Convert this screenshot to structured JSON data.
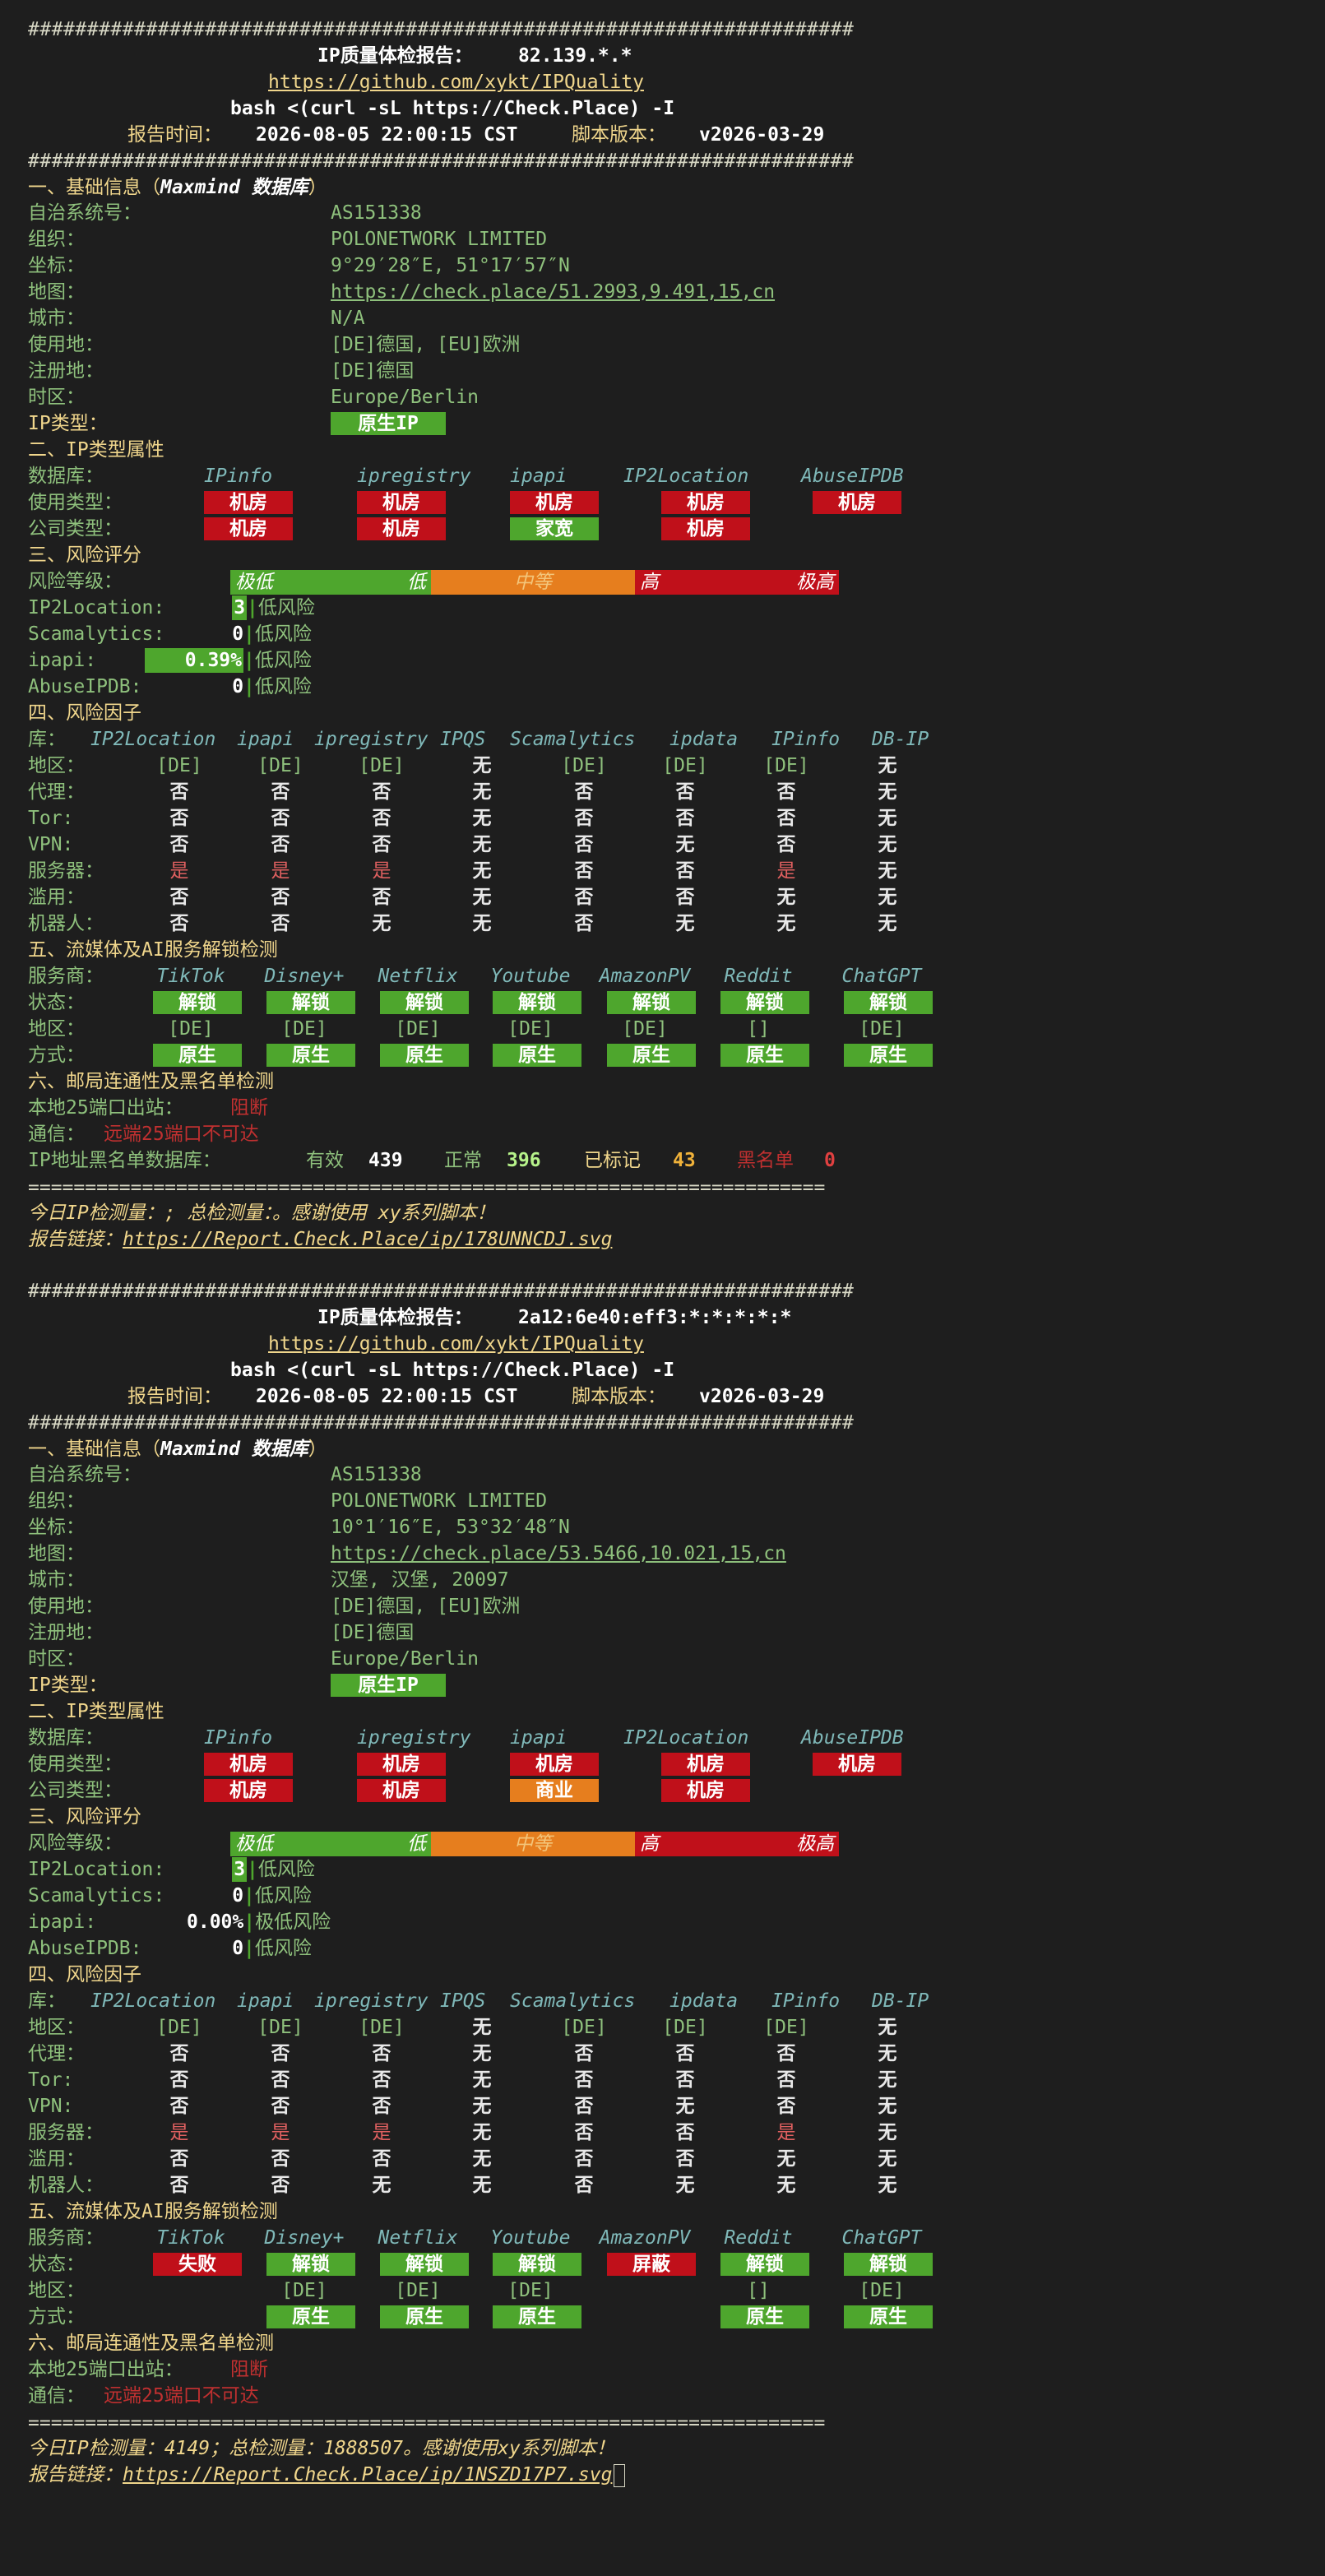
{
  "divider_hash": "######################################################################",
  "divider_eq": "======================================================================",
  "reports": [
    {
      "header": {
        "title_prefix": "IP质量体检报告：",
        "ip": "82.139.*.*",
        "repo": "https://github.com/xykt/IPQuality",
        "command": "bash <(curl -sL https://Check.Place) -I",
        "time_label": "报告时间：",
        "time_value": "2026-08-05 22:00:15 CST",
        "version_label": "脚本版本：",
        "version_value": "v2026-03-29"
      },
      "basic": {
        "title": "一、基础信息（",
        "db": "Maxmind 数据库",
        "title_end": "）",
        "rows": [
          {
            "label": "自治系统号：",
            "value": "AS151338"
          },
          {
            "label": "组织：",
            "value": "POLONETWORK LIMITED"
          },
          {
            "label": "坐标：",
            "value": "9°29′28″E, 51°17′57″N"
          },
          {
            "label": "地图：",
            "value": "https://check.place/51.2993,9.491,15,cn"
          },
          {
            "label": "城市：",
            "value": "N/A"
          },
          {
            "label": "使用地：",
            "value": "[DE]德国, [EU]欧洲"
          },
          {
            "label": "注册地：",
            "value": "[DE]德国"
          },
          {
            "label": "时区：",
            "value": "Europe/Berlin"
          }
        ],
        "ip_type_label": "IP类型：",
        "ip_type_value": "原生IP"
      },
      "iptype": {
        "title": "二、IP类型属性",
        "db_label": "数据库：",
        "dbs": [
          "IPinfo",
          "ipregistry",
          "ipapi",
          "IP2Location",
          "AbuseIPDB"
        ],
        "usage_label": "使用类型：",
        "usage": [
          {
            "t": "机房",
            "c": "r"
          },
          {
            "t": "机房",
            "c": "r"
          },
          {
            "t": "机房",
            "c": "r"
          },
          {
            "t": "机房",
            "c": "r"
          },
          {
            "t": "机房",
            "c": "r"
          }
        ],
        "company_label": "公司类型：",
        "company": [
          {
            "t": "机房",
            "c": "r"
          },
          {
            "t": "机房",
            "c": "r"
          },
          {
            "t": "家宽",
            "c": "g"
          },
          {
            "t": "机房",
            "c": "r"
          }
        ]
      },
      "risk": {
        "title": "三、风险评分",
        "level_label": "风险等级：",
        "levels": [
          "极低",
          "低",
          "中等",
          "高",
          "极高"
        ],
        "rows": [
          {
            "label": "IP2Location:",
            "score": "3",
            "text": "低风险",
            "fill": 0.03
          },
          {
            "label": "Scamalytics:",
            "score": "0",
            "text": "低风险",
            "fill": 0.0
          },
          {
            "label": "ipapi:",
            "score": "0.39%",
            "text": "低风险",
            "fill": 0.39
          },
          {
            "label": "AbuseIPDB:",
            "score": "0",
            "text": "低风险",
            "fill": 0.0
          }
        ]
      },
      "factors": {
        "title": "四、风险因子",
        "lib_label": "库：",
        "cols": [
          "IP2Location",
          "ipapi",
          "ipregistry",
          "IPQS",
          "Scamalytics",
          "ipdata",
          "IPinfo",
          "DB-IP"
        ],
        "rows": [
          {
            "label": "地区：",
            "vals": [
              "[DE]",
              "[DE]",
              "[DE]",
              "无",
              "[DE]",
              "[DE]",
              "[DE]",
              "无"
            ]
          },
          {
            "label": "代理：",
            "vals": [
              "否",
              "否",
              "否",
              "无",
              "否",
              "否",
              "否",
              "无"
            ]
          },
          {
            "label": "Tor:",
            "vals": [
              "否",
              "否",
              "否",
              "无",
              "否",
              "否",
              "否",
              "无"
            ]
          },
          {
            "label": "VPN:",
            "vals": [
              "否",
              "否",
              "否",
              "无",
              "否",
              "无",
              "否",
              "无"
            ]
          },
          {
            "label": "服务器：",
            "vals": [
              "是",
              "是",
              "是",
              "无",
              "否",
              "否",
              "是",
              "无"
            ]
          },
          {
            "label": "滥用：",
            "vals": [
              "否",
              "否",
              "否",
              "无",
              "否",
              "否",
              "无",
              "无"
            ]
          },
          {
            "label": "机器人：",
            "vals": [
              "否",
              "否",
              "无",
              "无",
              "否",
              "无",
              "无",
              "无"
            ]
          }
        ]
      },
      "media": {
        "title": "五、流媒体及AI服务解锁检测",
        "svc_label": "服务商：",
        "services": [
          "TikTok",
          "Disney+",
          "Netflix",
          "Youtube",
          "AmazonPV",
          "Reddit",
          "ChatGPT"
        ],
        "status_label": "状态：",
        "status": [
          {
            "t": "解锁",
            "c": "g"
          },
          {
            "t": "解锁",
            "c": "g"
          },
          {
            "t": "解锁",
            "c": "g"
          },
          {
            "t": "解锁",
            "c": "g"
          },
          {
            "t": "解锁",
            "c": "g"
          },
          {
            "t": "解锁",
            "c": "g"
          },
          {
            "t": "解锁",
            "c": "g"
          }
        ],
        "region_label": "地区：",
        "region": [
          "[DE]",
          "[DE]",
          "[DE]",
          "[DE]",
          "[DE]",
          "[]",
          "[DE]"
        ],
        "method_label": "方式：",
        "method": [
          "原生",
          "原生",
          "原生",
          "原生",
          "原生",
          "原生",
          "原生"
        ]
      },
      "mail": {
        "title": "六、邮局连通性及黑名单检测",
        "port_label": "本地25端口出站：",
        "port_value": "阻断",
        "conn_label": "通信：",
        "conn_value": "远端25端口不可达",
        "bl_label": "IP地址黑名单数据库：",
        "valid_label": "有效",
        "valid": "439",
        "normal_label": "正常",
        "normal": "396",
        "marked_label": "已标记",
        "marked": "43",
        "black_label": "黑名单",
        "black": "0"
      },
      "footer": {
        "stats": "今日IP检测量：; 总检测量：。感谢使用 xy系列脚本！",
        "link_label": "报告链接：",
        "link": "https://Report.Check.Place/ip/178UNNCDJ.svg"
      }
    },
    {
      "header": {
        "title_prefix": "IP质量体检报告：",
        "ip": "2a12:6e40:eff3:*:*:*:*:*",
        "repo": "https://github.com/xykt/IPQuality",
        "command": "bash <(curl -sL https://Check.Place) -I",
        "time_label": "报告时间：",
        "time_value": "2026-08-05 22:00:15 CST",
        "version_label": "脚本版本：",
        "version_value": "v2026-03-29"
      },
      "basic": {
        "title": "一、基础信息（",
        "db": "Maxmind 数据库",
        "title_end": "）",
        "rows": [
          {
            "label": "自治系统号：",
            "value": "AS151338"
          },
          {
            "label": "组织：",
            "value": "POLONETWORK LIMITED"
          },
          {
            "label": "坐标：",
            "value": "10°1′16″E, 53°32′48″N"
          },
          {
            "label": "地图：",
            "value": "https://check.place/53.5466,10.021,15,cn"
          },
          {
            "label": "城市：",
            "value": "汉堡, 汉堡, 20097"
          },
          {
            "label": "使用地：",
            "value": "[DE]德国, [EU]欧洲"
          },
          {
            "label": "注册地：",
            "value": "[DE]德国"
          },
          {
            "label": "时区：",
            "value": "Europe/Berlin"
          }
        ],
        "ip_type_label": "IP类型：",
        "ip_type_value": "原生IP"
      },
      "iptype": {
        "title": "二、IP类型属性",
        "db_label": "数据库：",
        "dbs": [
          "IPinfo",
          "ipregistry",
          "ipapi",
          "IP2Location",
          "AbuseIPDB"
        ],
        "usage_label": "使用类型：",
        "usage": [
          {
            "t": "机房",
            "c": "r"
          },
          {
            "t": "机房",
            "c": "r"
          },
          {
            "t": "机房",
            "c": "r"
          },
          {
            "t": "机房",
            "c": "r"
          },
          {
            "t": "机房",
            "c": "r"
          }
        ],
        "company_label": "公司类型：",
        "company": [
          {
            "t": "机房",
            "c": "r"
          },
          {
            "t": "机房",
            "c": "r"
          },
          {
            "t": "商业",
            "c": "o"
          },
          {
            "t": "机房",
            "c": "r"
          }
        ]
      },
      "risk": {
        "title": "三、风险评分",
        "level_label": "风险等级：",
        "levels": [
          "极低",
          "低",
          "中等",
          "高",
          "极高"
        ],
        "rows": [
          {
            "label": "IP2Location:",
            "score": "3",
            "text": "低风险",
            "fill": 0.03
          },
          {
            "label": "Scamalytics:",
            "score": "0",
            "text": "低风险",
            "fill": 0.0
          },
          {
            "label": "ipapi:",
            "score": "0.00%",
            "text": "极低风险",
            "fill": 0.0
          },
          {
            "label": "AbuseIPDB:",
            "score": "0",
            "text": "低风险",
            "fill": 0.0
          }
        ]
      },
      "factors": {
        "title": "四、风险因子",
        "lib_label": "库：",
        "cols": [
          "IP2Location",
          "ipapi",
          "ipregistry",
          "IPQS",
          "Scamalytics",
          "ipdata",
          "IPinfo",
          "DB-IP"
        ],
        "rows": [
          {
            "label": "地区：",
            "vals": [
              "[DE]",
              "[DE]",
              "[DE]",
              "无",
              "[DE]",
              "[DE]",
              "[DE]",
              "无"
            ]
          },
          {
            "label": "代理：",
            "vals": [
              "否",
              "否",
              "否",
              "无",
              "否",
              "否",
              "否",
              "无"
            ]
          },
          {
            "label": "Tor:",
            "vals": [
              "否",
              "否",
              "否",
              "无",
              "否",
              "否",
              "否",
              "无"
            ]
          },
          {
            "label": "VPN:",
            "vals": [
              "否",
              "否",
              "否",
              "无",
              "否",
              "无",
              "否",
              "无"
            ]
          },
          {
            "label": "服务器：",
            "vals": [
              "是",
              "是",
              "是",
              "无",
              "否",
              "否",
              "是",
              "无"
            ]
          },
          {
            "label": "滥用：",
            "vals": [
              "否",
              "否",
              "否",
              "无",
              "否",
              "否",
              "无",
              "无"
            ]
          },
          {
            "label": "机器人：",
            "vals": [
              "否",
              "否",
              "无",
              "无",
              "否",
              "无",
              "无",
              "无"
            ]
          }
        ]
      },
      "media": {
        "title": "五、流媒体及AI服务解锁检测",
        "svc_label": "服务商：",
        "services": [
          "TikTok",
          "Disney+",
          "Netflix",
          "Youtube",
          "AmazonPV",
          "Reddit",
          "ChatGPT"
        ],
        "status_label": "状态：",
        "status": [
          {
            "t": "失败",
            "c": "r"
          },
          {
            "t": "解锁",
            "c": "g"
          },
          {
            "t": "解锁",
            "c": "g"
          },
          {
            "t": "解锁",
            "c": "g"
          },
          {
            "t": "屏蔽",
            "c": "r"
          },
          {
            "t": "解锁",
            "c": "g"
          },
          {
            "t": "解锁",
            "c": "g"
          }
        ],
        "region_label": "地区：",
        "region": [
          "",
          "[DE]",
          "[DE]",
          "[DE]",
          "",
          "[]",
          "[DE]"
        ],
        "method_label": "方式：",
        "method": [
          "",
          "原生",
          "原生",
          "原生",
          "",
          "原生",
          "原生"
        ]
      },
      "mail": {
        "title": "六、邮局连通性及黑名单检测",
        "port_label": "本地25端口出站：",
        "port_value": "阻断",
        "conn_label": "通信：",
        "conn_value": "远端25端口不可达"
      },
      "footer": {
        "stats": "今日IP检测量：4149；总检测量：1888507。感谢使用xy系列脚本！",
        "link_label": "报告链接：",
        "link": "https://Report.Check.Place/ip/1NSZD17P7.svg"
      }
    }
  ]
}
